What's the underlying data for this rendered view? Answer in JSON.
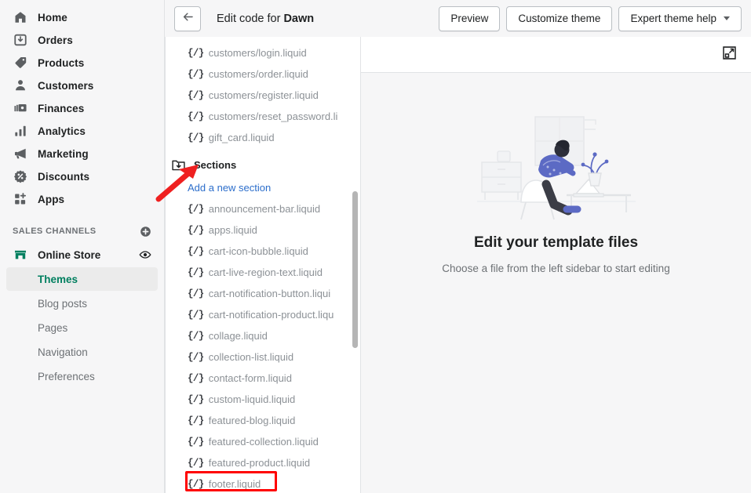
{
  "sidebar": {
    "items": [
      {
        "label": "Home",
        "icon": "home-icon"
      },
      {
        "label": "Orders",
        "icon": "orders-icon"
      },
      {
        "label": "Products",
        "icon": "products-tag-icon"
      },
      {
        "label": "Customers",
        "icon": "customers-person-icon"
      },
      {
        "label": "Finances",
        "icon": "finances-cash-icon"
      },
      {
        "label": "Analytics",
        "icon": "analytics-bars-icon"
      },
      {
        "label": "Marketing",
        "icon": "marketing-megaphone-icon"
      },
      {
        "label": "Discounts",
        "icon": "discounts-tag-percent-icon"
      },
      {
        "label": "Apps",
        "icon": "apps-grid-plus-icon"
      }
    ],
    "sales_channels": {
      "title": "SALES CHANNELS",
      "add_icon": "plus-circle-icon",
      "store": {
        "label": "Online Store",
        "icon": "storefront-icon",
        "view_icon": "eye-icon"
      },
      "sub_items": [
        {
          "label": "Themes",
          "active": true
        },
        {
          "label": "Blog posts",
          "active": false
        },
        {
          "label": "Pages",
          "active": false
        },
        {
          "label": "Navigation",
          "active": false
        },
        {
          "label": "Preferences",
          "active": false
        }
      ]
    }
  },
  "topbar": {
    "back_icon": "arrow-left-icon",
    "title_prefix": "Edit code for ",
    "title_theme": "Dawn",
    "buttons": [
      {
        "label": "Preview",
        "caret": false
      },
      {
        "label": "Customize theme",
        "caret": false
      },
      {
        "label": "Expert theme help",
        "caret": true
      }
    ]
  },
  "filepanel": {
    "file_icon_glyph": "{/}",
    "top_files": [
      "customers/login.liquid",
      "customers/order.liquid",
      "customers/register.liquid",
      "customers/reset_password.li",
      "gift_card.liquid"
    ],
    "folder": {
      "label": "Sections",
      "icon": "folder-download-icon"
    },
    "add_link": "Add a new section",
    "section_files": [
      "announcement-bar.liquid",
      "apps.liquid",
      "cart-icon-bubble.liquid",
      "cart-live-region-text.liquid",
      "cart-notification-button.liqui",
      "cart-notification-product.liqu",
      "collage.liquid",
      "collection-list.liquid",
      "contact-form.liquid",
      "custom-liquid.liquid",
      "featured-blog.liquid",
      "featured-collection.liquid",
      "featured-product.liquid",
      "footer.liquid"
    ],
    "highlighted_file": "footer.liquid"
  },
  "editor": {
    "expand_icon": "expand-fullscreen-icon",
    "empty_title": "Edit your template files",
    "empty_subtitle": "Choose a file from the left sidebar to start editing",
    "illustration": "person-at-desk-illustration"
  },
  "annotations": {
    "arrow": "red-arrow-pointing-to-sections-folder",
    "box": "red-box-around-footer-liquid"
  },
  "colors": {
    "accent_green": "#007f5f",
    "link_blue": "#2c6ecb",
    "annotation_red": "#ff0000",
    "app_bg": "#f6f6f7"
  }
}
